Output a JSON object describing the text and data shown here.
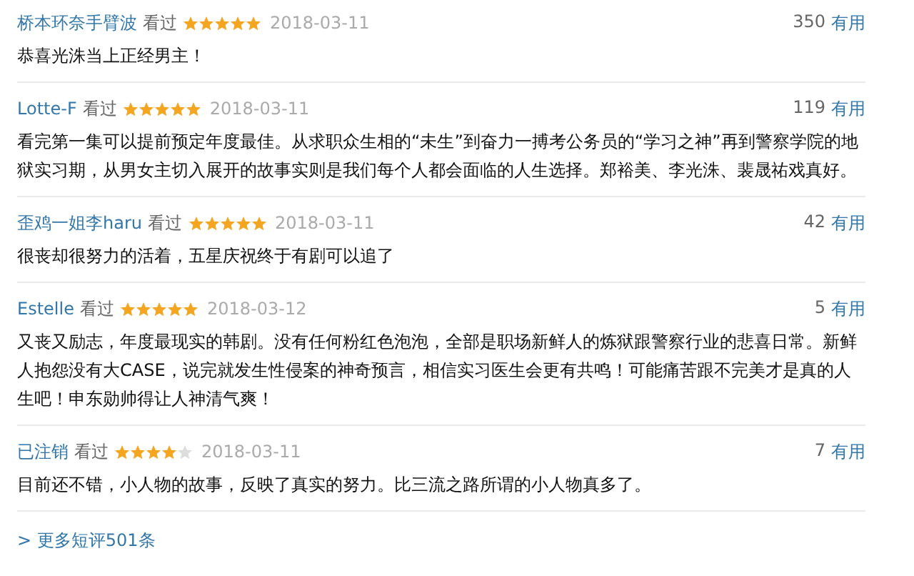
{
  "reviews": [
    {
      "user": "桥本环奈手臂波",
      "status": "看过",
      "stars": 5,
      "date": "2018-03-11",
      "votes": "350",
      "vote_label": "有用",
      "text": "恭喜光洙当上正经男主！"
    },
    {
      "user": "Lotte-F",
      "status": "看过",
      "stars": 5,
      "date": "2018-03-11",
      "votes": "119",
      "vote_label": "有用",
      "text": "看完第一集可以提前预定年度最佳。从求职众生相的“未生”到奋力一搏考公务员的“学习之神”再到警察学院的地狱实习期，从男女主切入展开的故事实则是我们每个人都会面临的人生选择。郑裕美、李光洙、裴晟祐戏真好。"
    },
    {
      "user": "歪鸡一姐李haru",
      "status": "看过",
      "stars": 5,
      "date": "2018-03-11",
      "votes": "42",
      "vote_label": "有用",
      "text": "很丧却很努力的活着，五星庆祝终于有剧可以追了"
    },
    {
      "user": "Estelle",
      "status": "看过",
      "stars": 5,
      "date": "2018-03-12",
      "votes": "5",
      "vote_label": "有用",
      "text": "又丧又励志，年度最现实的韩剧。没有任何粉红色泡泡，全部是职场新鲜人的炼狱跟警察行业的悲喜日常。新鲜人抱怨没有大CASE，说完就发生性侵案的神奇预言，相信实习医生会更有共鸣！可能痛苦跟不完美才是真的人生吧！申东勋帅得让人神清气爽！"
    },
    {
      "user": "已注销",
      "status": "看过",
      "stars": 4,
      "date": "2018-03-11",
      "votes": "7",
      "vote_label": "有用",
      "text": "目前还不错，小人物的故事，反映了真实的努力。比三流之路所谓的小人物真多了。"
    }
  ],
  "more_link": "> 更多短评501条"
}
